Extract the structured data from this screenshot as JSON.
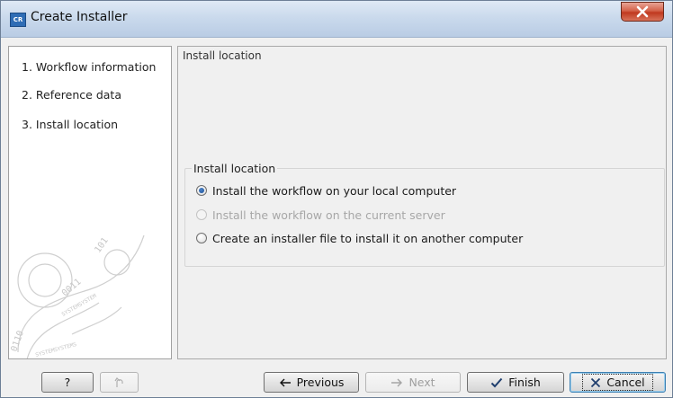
{
  "window": {
    "title": "Create Installer",
    "app_icon_text": "CR"
  },
  "steps": [
    {
      "label": "1.  Workflow information"
    },
    {
      "label": "2.  Reference data"
    },
    {
      "label": "3.  Install location"
    }
  ],
  "content": {
    "header": "Install location",
    "group_title": "Install location",
    "options": [
      {
        "label": "Install the workflow on your local computer",
        "selected": true,
        "enabled": true
      },
      {
        "label": "Install the workflow on the current server",
        "selected": false,
        "enabled": false
      },
      {
        "label": "Create an installer file to install it on another computer",
        "selected": false,
        "enabled": true
      }
    ]
  },
  "buttons": {
    "help": "?",
    "previous": "Previous",
    "next": "Next",
    "finish": "Finish",
    "cancel": "Cancel"
  },
  "icons": {
    "help": "help-icon",
    "restore": "restore-defaults-icon",
    "previous": "arrow-left-icon",
    "next": "arrow-right-icon",
    "finish": "checkmark-icon",
    "cancel": "x-icon",
    "close": "close-icon"
  },
  "colors": {
    "close_button": "#c9452b",
    "titlebar": "#c9d9ec",
    "radio_selected": "#1a4f96"
  }
}
